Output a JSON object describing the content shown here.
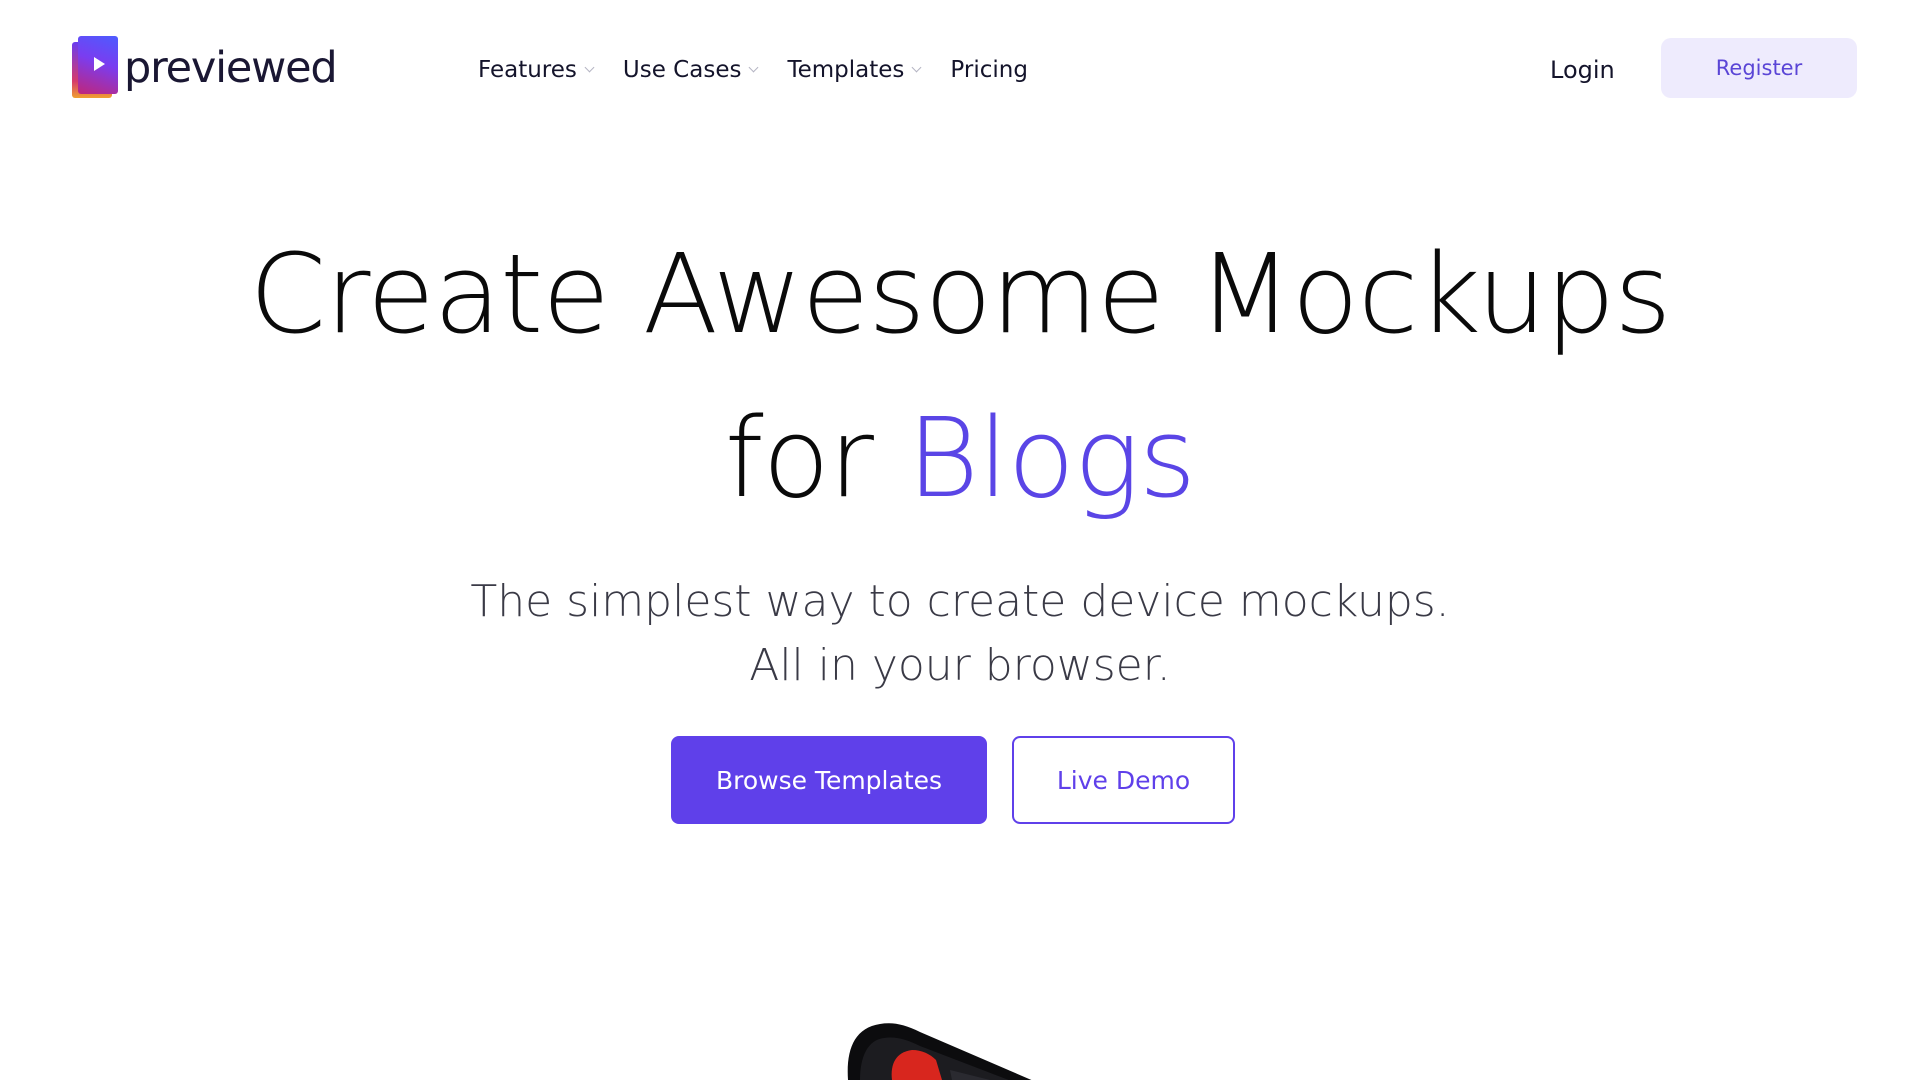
{
  "brand": {
    "name": "previewed",
    "accent_color": "#5F40EA"
  },
  "nav": {
    "items": [
      {
        "label": "Features",
        "has_dropdown": true
      },
      {
        "label": "Use Cases",
        "has_dropdown": true
      },
      {
        "label": "Templates",
        "has_dropdown": true
      },
      {
        "label": "Pricing",
        "has_dropdown": false
      }
    ],
    "login_label": "Login",
    "register_label": "Register"
  },
  "hero": {
    "title_line1": "Create Awesome Mockups",
    "title_line2_prefix": "for ",
    "title_line2_accent": "Blogs",
    "subtitle_line1": "The simplest way to create device mockups.",
    "subtitle_line2": "All in your browser.",
    "primary_button": "Browse Templates",
    "secondary_button": "Live Demo"
  }
}
